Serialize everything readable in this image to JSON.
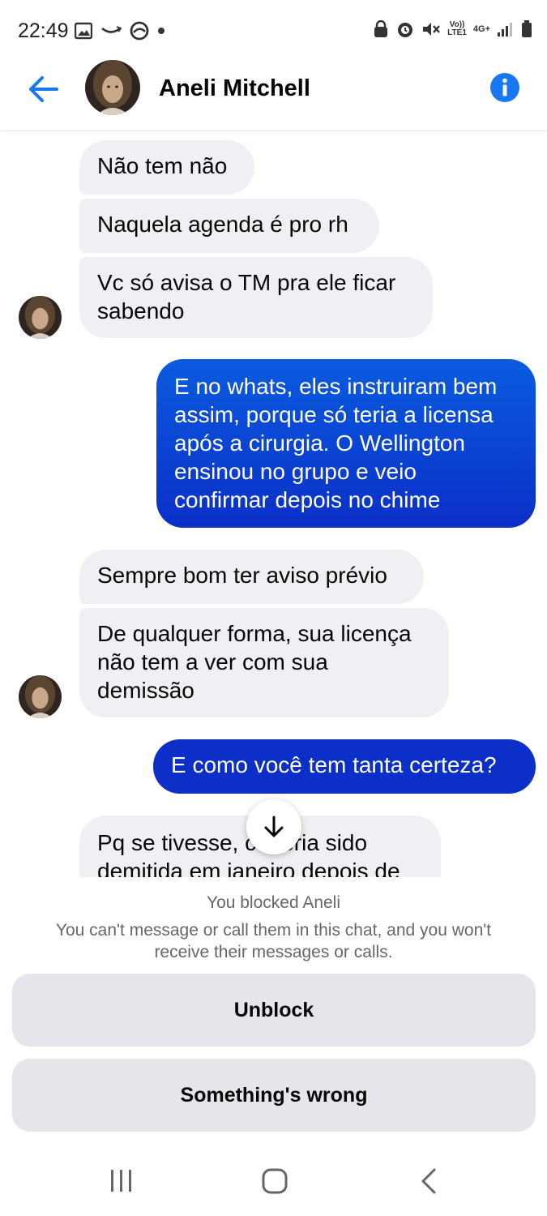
{
  "status_bar": {
    "time": "22:49",
    "network_label": "4G+",
    "volte_label": "Vo))\nLTE1"
  },
  "header": {
    "contact_name": "Aneli Mitchell"
  },
  "messages": [
    {
      "direction": "in",
      "text": "Não tem não"
    },
    {
      "direction": "in",
      "text": "Naquela agenda é pro rh"
    },
    {
      "direction": "in",
      "lines": [
        "Vc só avisa o TM pra ele ficar",
        "sabendo"
      ]
    },
    {
      "direction": "out",
      "lines": [
        "E no whats, eles instruiram bem",
        "assim, porque só teria a licensa",
        "após a cirurgia. O Wellington",
        "ensinou no grupo e veio",
        "confirmar depois no chime"
      ]
    },
    {
      "direction": "in",
      "text": "Sempre bom ter aviso prévio"
    },
    {
      "direction": "in",
      "lines": [
        "De qualquer forma, sua licença",
        "não tem a ver com sua",
        "demissão"
      ]
    },
    {
      "direction": "out",
      "text": "E como você tem tanta certeza?"
    },
    {
      "direction": "in",
      "lines": [
        "Pq se tivesse, c   teria sido",
        "demitida em janeiro depois de"
      ]
    }
  ],
  "blocked_panel": {
    "title": "You blocked Aneli",
    "description": "You can't message or call them in this chat, and you won't receive their messages or calls.",
    "unblock_label": "Unblock",
    "wrong_label": "Something's wrong"
  },
  "colors": {
    "accent": "#1877f2",
    "outgoing_top": "#0a5ce0",
    "outgoing_bottom": "#0b2fc7",
    "incoming_bg": "#eff0f3"
  },
  "icons": [
    "back-arrow-icon",
    "info-icon",
    "arrow-down-icon",
    "recents-icon",
    "home-icon",
    "nav-back-icon"
  ]
}
